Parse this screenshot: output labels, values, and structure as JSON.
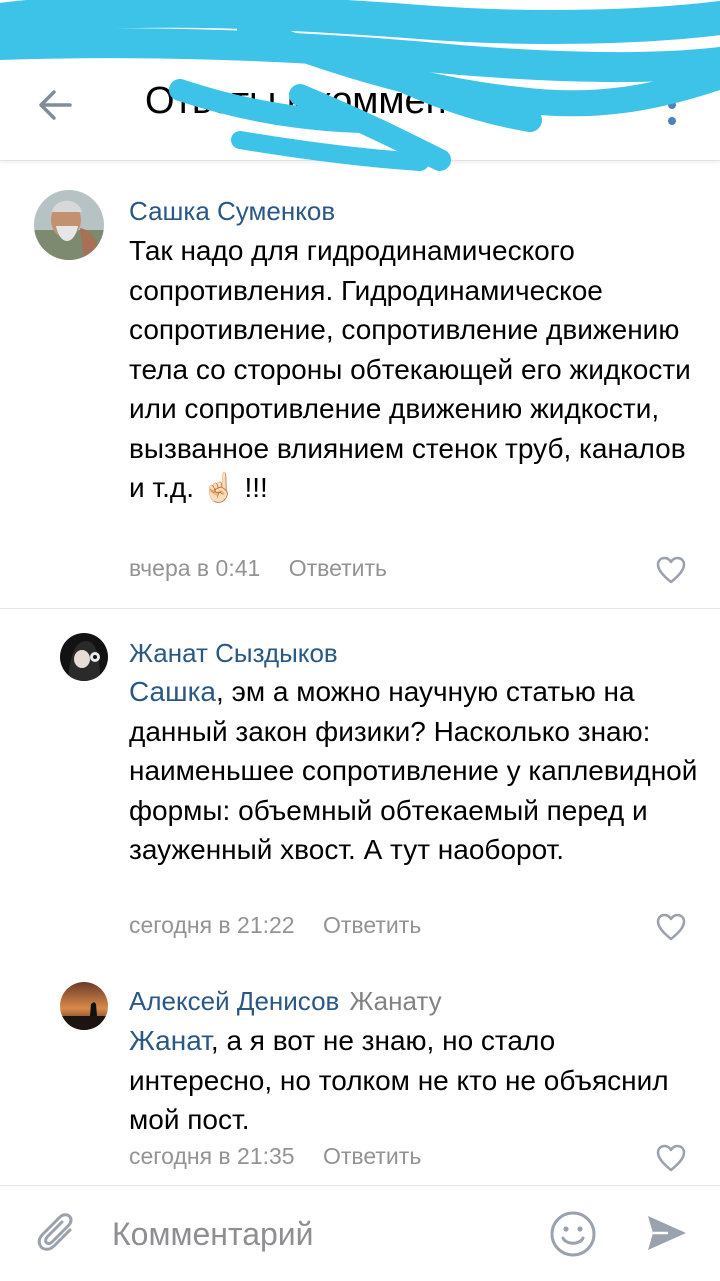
{
  "header": {
    "title": "Ответы к комментарию"
  },
  "comments": [
    {
      "author": "Сашка Суменков",
      "text": "Так надо для гидродинамического сопротивления. Гидродинамическое сопротивление, сопротивление движению тела со стороны обтекающей его жидкости или сопротивление движению жидкости, вызванное влиянием стенок труб, каналов и т.д. ☝🏻 !!!",
      "time": "вчера в 0:41",
      "reply_label": "Ответить"
    },
    {
      "author": "Жанат Сыздыков",
      "mention": "Сашка",
      "text": ", эм а можно научную статью на данный закон физики? Насколько знаю: наименьшее сопротивление у каплевидной формы: объемный обтекаемый перед и зауженный хвост. А тут наоборот.",
      "time": "сегодня в 21:22",
      "reply_label": "Ответить"
    },
    {
      "author": "Алексей Денисов",
      "reply_to": "Жанату",
      "mention": "Жанат",
      "text": ", а я вот не знаю, но стало интересно, но толком не кто не объяснил мой пост.",
      "time": "сегодня в 21:35",
      "reply_label": "Ответить"
    }
  ],
  "composer": {
    "placeholder": "Комментарий"
  },
  "icons": {
    "back": "arrow-left-icon",
    "more": "more-vertical-icon",
    "like": "heart-outline-icon",
    "attach": "paperclip-icon",
    "emoji": "smile-icon",
    "send": "send-icon"
  },
  "colors": {
    "accent": "#2a5885",
    "icon": "#99a2ad",
    "header_icon": "#5181b8",
    "scribble": "#3ec3e8"
  }
}
